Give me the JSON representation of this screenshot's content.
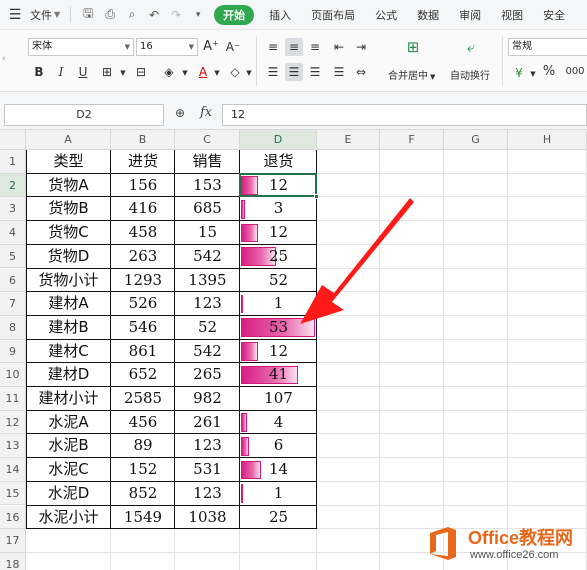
{
  "menubar": {
    "file_label": "文件",
    "tabs": [
      "开始",
      "插入",
      "页面布局",
      "公式",
      "数据",
      "审阅",
      "视图",
      "安全"
    ],
    "active_tab": "开始"
  },
  "ribbon": {
    "font_name": "宋体",
    "font_size": "16",
    "merge_label": "合并居中",
    "wrap_label": "自动换行",
    "number_format": "常规",
    "percent": "%",
    "thousands": "000"
  },
  "formula_bar": {
    "name_box": "D2",
    "fx_label": "fx",
    "value": "12"
  },
  "columns": [
    "A",
    "B",
    "C",
    "D",
    "E",
    "F",
    "G",
    "H"
  ],
  "rows": [
    "1",
    "2",
    "3",
    "4",
    "5",
    "6",
    "7",
    "8",
    "9",
    "10",
    "11",
    "12",
    "13",
    "14",
    "15",
    "16",
    "17",
    "18"
  ],
  "table": {
    "headers": [
      "类型",
      "进货",
      "销售",
      "退货"
    ],
    "rows": [
      [
        "货物A",
        "156",
        "153",
        "12"
      ],
      [
        "货物B",
        "416",
        "685",
        "3"
      ],
      [
        "货物C",
        "458",
        "15",
        "12"
      ],
      [
        "货物D",
        "263",
        "542",
        "25"
      ],
      [
        "货物小计",
        "1293",
        "1395",
        "52"
      ],
      [
        "建材A",
        "526",
        "123",
        "1"
      ],
      [
        "建材B",
        "546",
        "52",
        "53"
      ],
      [
        "建材C",
        "861",
        "542",
        "12"
      ],
      [
        "建材D",
        "652",
        "265",
        "41"
      ],
      [
        "建材小计",
        "2585",
        "982",
        "107"
      ],
      [
        "水泥A",
        "456",
        "261",
        "4"
      ],
      [
        "水泥B",
        "89",
        "123",
        "6"
      ],
      [
        "水泥C",
        "152",
        "531",
        "14"
      ],
      [
        "水泥D",
        "852",
        "123",
        "1"
      ],
      [
        "水泥小计",
        "1549",
        "1038",
        "25"
      ]
    ],
    "databar": [
      12,
      3,
      12,
      25,
      null,
      1,
      53,
      12,
      41,
      null,
      4,
      6,
      14,
      1,
      null
    ],
    "databar_max": 53,
    "databar_color": "#d71e84"
  },
  "watermark": {
    "brand_office": "Office",
    "brand_cn": "教程网",
    "url": "www.office26.com",
    "color": "#e8681b"
  }
}
